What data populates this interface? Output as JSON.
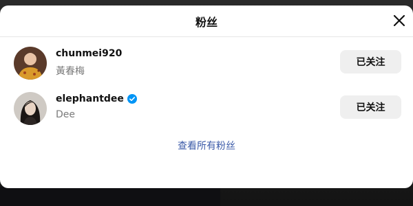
{
  "modal": {
    "title": "粉丝"
  },
  "followers": [
    {
      "username": "chunmei920",
      "fullname": "黃春梅",
      "verified": false,
      "button_label": "已关注"
    },
    {
      "username": "elephantdee",
      "fullname": "Dee",
      "verified": true,
      "button_label": "已关注"
    }
  ],
  "footer": {
    "see_all_label": "查看所有粉丝"
  },
  "colors": {
    "verified_blue": "#0095f6",
    "link_blue": "#3b5aa8",
    "button_bg": "#efefef"
  },
  "icons": {
    "close": "close-icon",
    "verified": "verified-badge-icon"
  }
}
